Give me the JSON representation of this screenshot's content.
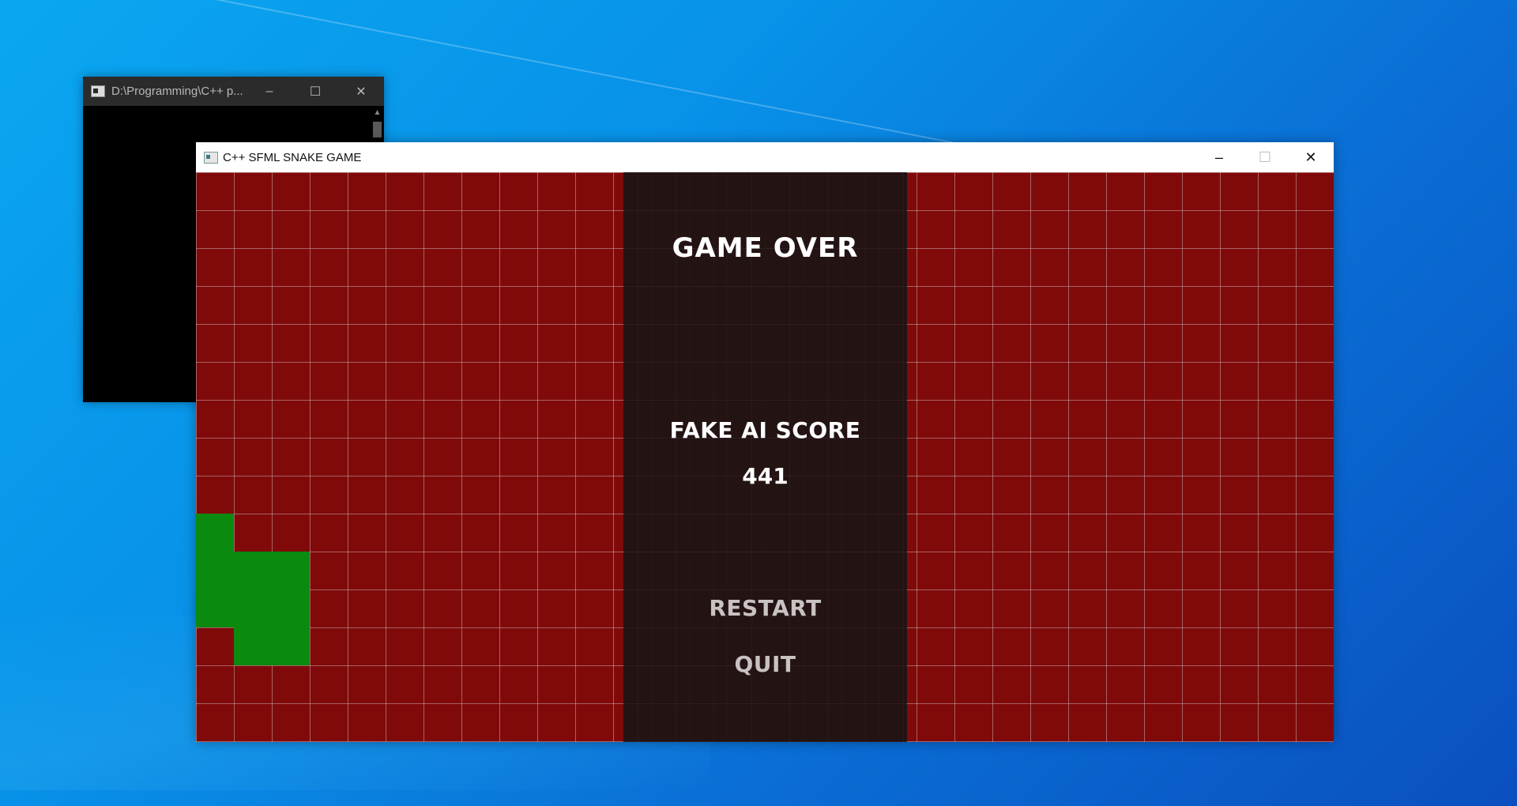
{
  "console_window": {
    "title": "D:\\Programming\\C++ p...",
    "minimize_glyph": "–",
    "maximize_glyph": "☐",
    "close_glyph": "✕",
    "scroll_up_glyph": "▲"
  },
  "game_window": {
    "title": "C++ SFML SNAKE GAME",
    "minimize_glyph": "–",
    "maximize_glyph": "☐",
    "close_glyph": "✕"
  },
  "board": {
    "cell_color": "#800a0a",
    "snake_color": "#0a8a0f",
    "columns": 30,
    "rows": 15,
    "snake_cells": [
      [
        0,
        9
      ],
      [
        0,
        10
      ],
      [
        1,
        10
      ],
      [
        2,
        10
      ],
      [
        0,
        11
      ],
      [
        1,
        11
      ],
      [
        2,
        11
      ],
      [
        1,
        12
      ],
      [
        2,
        12
      ]
    ]
  },
  "overlay": {
    "title": "GAME OVER",
    "score_label": "FAKE AI SCORE",
    "score_value": "441",
    "restart_label": "RESTART",
    "quit_label": "QUIT"
  },
  "colors": {
    "desktop_accent": "#0a8fe8",
    "overlay_bg": "#201414",
    "menu_text": "#c9c2c2"
  }
}
